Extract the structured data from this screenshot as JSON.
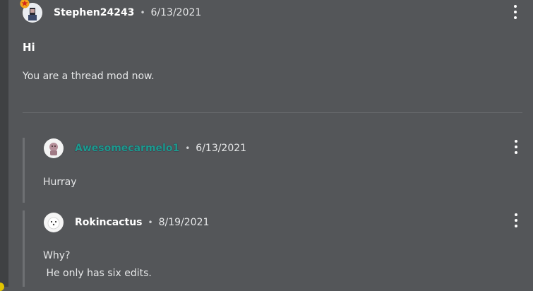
{
  "colors": {
    "background": "#545659",
    "rail": "#3f4143",
    "teal_username": "#1f9a8c"
  },
  "post": {
    "author": "Stephen24243",
    "date": "6/13/2021",
    "title": "Hi",
    "body": "You are a thread mod now.",
    "avatar_icon": "avatar-with-star-badge"
  },
  "replies": [
    {
      "author": "Awesomecarmelo1",
      "date": "6/13/2021",
      "body_lines": [
        "Hurray"
      ],
      "avatar_icon": "avatar-icon"
    },
    {
      "author": "Rokincactus",
      "date": "8/19/2021",
      "body_lines": [
        "Why?",
        " He only has six edits."
      ],
      "avatar_icon": "avatar-icon"
    }
  ],
  "separator": "•"
}
